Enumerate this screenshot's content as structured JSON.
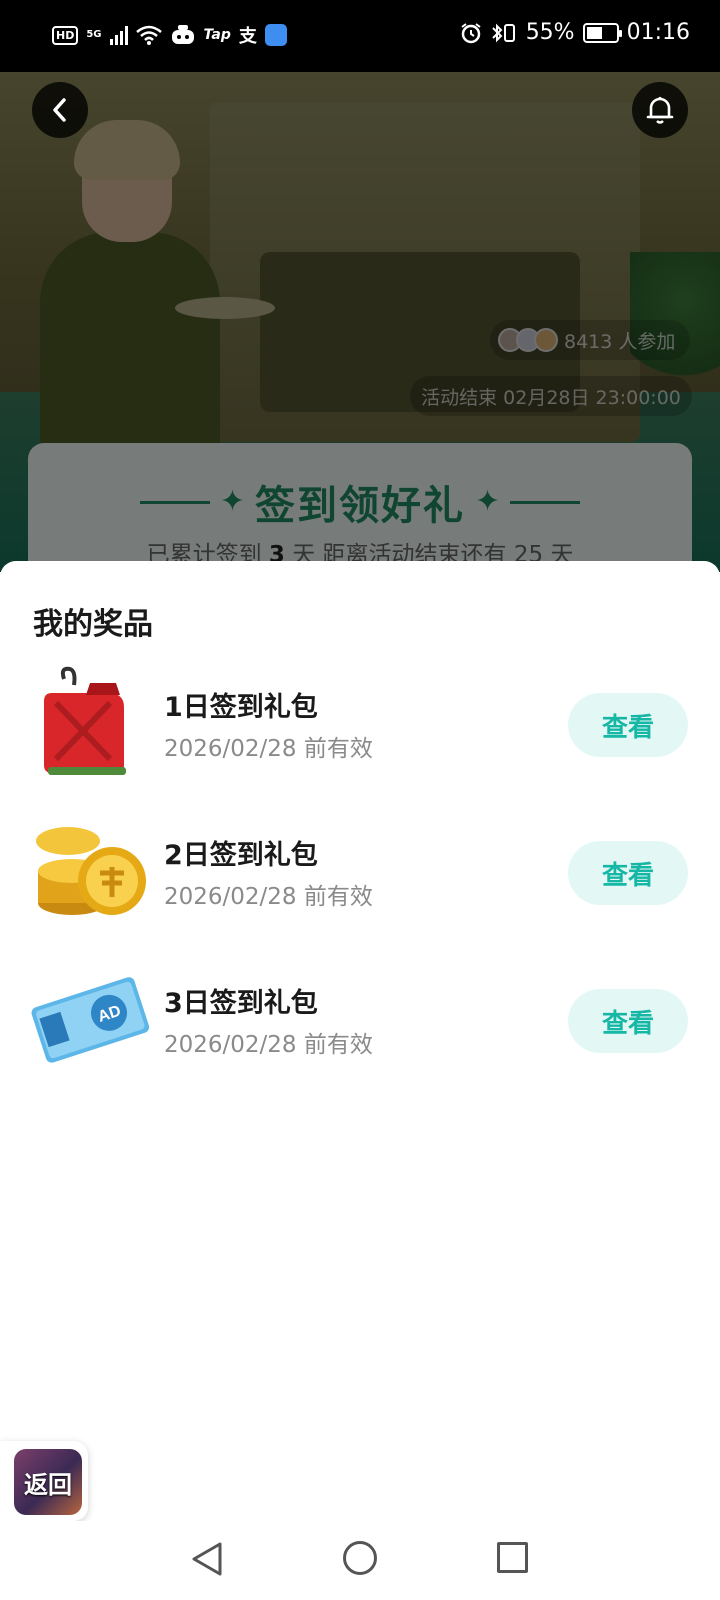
{
  "status_bar": {
    "left_labels": [
      "HD",
      "5G",
      "Tap",
      "支"
    ],
    "battery_percent": "55%",
    "battery_level": 0.55,
    "time": "01:16"
  },
  "banner": {
    "participants_text": "8413 人参加",
    "deadline_text": "活动结束 02月28日 23:00:00"
  },
  "signin_card": {
    "title": "签到领好礼",
    "sub_prefix": "已累计签到 ",
    "signed_days": "3",
    "sub_middle": " 天  距离活动结束还有 ",
    "days_left": "25",
    "sub_suffix": " 天"
  },
  "sheet": {
    "title": "我的奖品",
    "prizes": [
      {
        "name": "1日签到礼包",
        "expiry": "2026/02/28 前有效",
        "button": "查看",
        "icon": "fuel-can-icon"
      },
      {
        "name": "2日签到礼包",
        "expiry": "2026/02/28 前有效",
        "button": "查看",
        "icon": "gold-coins-icon"
      },
      {
        "name": "3日签到礼包",
        "expiry": "2026/02/28 前有效",
        "button": "查看",
        "icon": "ad-ticket-icon"
      }
    ]
  },
  "floating_return": {
    "label": "返回"
  },
  "ad_ticket_text": "AD",
  "colors": {
    "accent_teal": "#17b7a5",
    "button_bg": "#e3f8f5",
    "signin_green": "#1e8a63"
  }
}
